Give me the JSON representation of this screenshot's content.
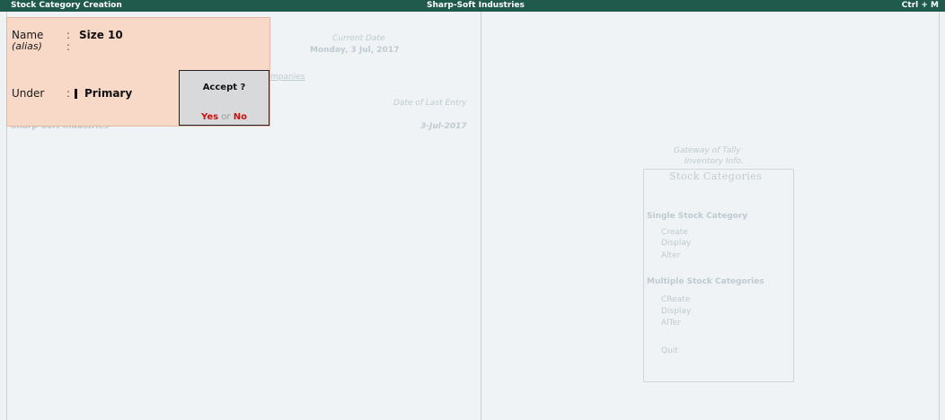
{
  "titlebar": {
    "left": "Stock Category Creation",
    "center": "Sharp-Soft Industries",
    "right": "Ctrl + M"
  },
  "background": {
    "current_date_label": "Current Date",
    "current_date_value": "Monday, 3 Jul, 2017",
    "companies_label": "mpanies",
    "last_entry_label": "Date of Last Entry",
    "company_name": "Sharp-Soft Industries",
    "last_entry_value": "3-Jul-2017"
  },
  "gateway": {
    "title": "Gateway of Tally",
    "subtitle": "Inventory Info.",
    "heading": "Stock Categories",
    "single_section": "Single Stock Category",
    "single_items": [
      "Create",
      "Display",
      "Alter"
    ],
    "multiple_section": "Multiple Stock Categories",
    "multiple_items": [
      "CReate",
      "Display",
      "AlTer"
    ],
    "quit": "Quit"
  },
  "form": {
    "name_label": "Name",
    "name_value": "Size 10",
    "alias_label": "(alias)",
    "alias_value": "",
    "under_label": "Under",
    "under_value": "Primary",
    "colon": ":"
  },
  "dialog": {
    "title": "Accept ?",
    "yes": "Yes",
    "or": "or",
    "no": "No"
  },
  "colors": {
    "titlebar": "#1f5a4c",
    "form_bg": "#f8d8c6",
    "dialog_bg": "#d7d9da",
    "accent_red": "#cc1111"
  }
}
